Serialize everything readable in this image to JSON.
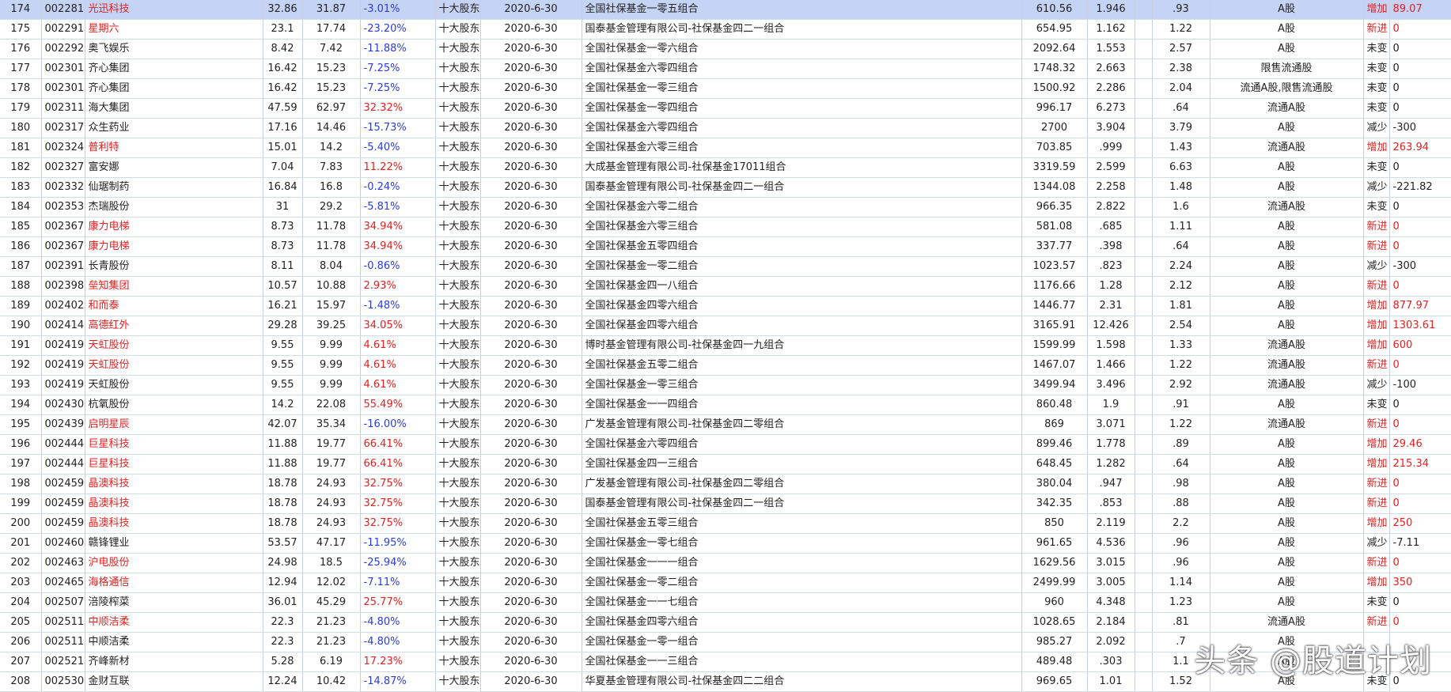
{
  "watermark": "头条 @股道计划",
  "colors": {
    "selected_row_bg": "#c5d3f5",
    "up": "#e62020",
    "down": "#2a3ddc",
    "grid": "#c8d0e0"
  },
  "rows": [
    {
      "idx": "174",
      "code": "002281",
      "name": "光迅科技",
      "name_red": true,
      "p1": "32.86",
      "p2": "31.87",
      "chg": "-3.01%",
      "holder_type": "十大股东",
      "date": "2020-6-30",
      "holder": "全国社保基金一零五组合",
      "amount": "610.56",
      "ratio": "1.946",
      "ratio2": ".93",
      "share_type": "A股",
      "change": "增加",
      "change_red": true,
      "delta": "89.07",
      "delta_red": true,
      "selected": true
    },
    {
      "idx": "175",
      "code": "002291",
      "name": "星期六",
      "name_red": true,
      "p1": "23.1",
      "p2": "17.74",
      "chg": "-23.20%",
      "holder_type": "十大股东",
      "date": "2020-6-30",
      "holder": "国泰基金管理有限公司-社保基金四二一组合",
      "amount": "654.95",
      "ratio": "1.162",
      "ratio2": "1.22",
      "share_type": "A股",
      "change": "新进",
      "change_red": true,
      "delta": "0",
      "delta_red": true
    },
    {
      "idx": "176",
      "code": "002292",
      "name": "奥飞娱乐",
      "name_red": false,
      "p1": "8.42",
      "p2": "7.42",
      "chg": "-11.88%",
      "holder_type": "十大股东",
      "date": "2020-6-30",
      "holder": "全国社保基金一零六组合",
      "amount": "2092.64",
      "ratio": "1.553",
      "ratio2": "2.57",
      "share_type": "A股",
      "change": "未变",
      "change_red": false,
      "delta": "0",
      "delta_red": false
    },
    {
      "idx": "177",
      "code": "002301",
      "name": "齐心集团",
      "name_red": false,
      "p1": "16.42",
      "p2": "15.23",
      "chg": "-7.25%",
      "holder_type": "十大股东",
      "date": "2020-6-30",
      "holder": "全国社保基金六零四组合",
      "amount": "1748.32",
      "ratio": "2.663",
      "ratio2": "2.38",
      "share_type": "限售流通股",
      "change": "未变",
      "change_red": false,
      "delta": "0",
      "delta_red": false
    },
    {
      "idx": "178",
      "code": "002301",
      "name": "齐心集团",
      "name_red": false,
      "p1": "16.42",
      "p2": "15.23",
      "chg": "-7.25%",
      "holder_type": "十大股东",
      "date": "2020-6-30",
      "holder": "全国社保基金一零三组合",
      "amount": "1500.92",
      "ratio": "2.286",
      "ratio2": "2.04",
      "share_type": "流通A股,限售流通股",
      "change": "未变",
      "change_red": false,
      "delta": "0",
      "delta_red": false
    },
    {
      "idx": "179",
      "code": "002311",
      "name": "海大集团",
      "name_red": false,
      "p1": "47.59",
      "p2": "62.97",
      "chg": "32.32%",
      "holder_type": "十大股东",
      "date": "2020-6-30",
      "holder": "全国社保基金一零四组合",
      "amount": "996.17",
      "ratio": "6.273",
      "ratio2": ".64",
      "share_type": "流通A股",
      "change": "未变",
      "change_red": false,
      "delta": "0",
      "delta_red": false
    },
    {
      "idx": "180",
      "code": "002317",
      "name": "众生药业",
      "name_red": false,
      "p1": "17.16",
      "p2": "14.46",
      "chg": "-15.73%",
      "holder_type": "十大股东",
      "date": "2020-6-30",
      "holder": "全国社保基金六零四组合",
      "amount": "2700",
      "ratio": "3.904",
      "ratio2": "3.79",
      "share_type": "A股",
      "change": "减少",
      "change_red": false,
      "delta": "-300",
      "delta_red": false
    },
    {
      "idx": "181",
      "code": "002324",
      "name": "普利特",
      "name_red": true,
      "p1": "15.01",
      "p2": "14.2",
      "chg": "-5.40%",
      "holder_type": "十大股东",
      "date": "2020-6-30",
      "holder": "全国社保基金六零三组合",
      "amount": "703.85",
      "ratio": ".999",
      "ratio2": "1.43",
      "share_type": "流通A股",
      "change": "增加",
      "change_red": true,
      "delta": "263.94",
      "delta_red": true
    },
    {
      "idx": "182",
      "code": "002327",
      "name": "富安娜",
      "name_red": false,
      "p1": "7.04",
      "p2": "7.83",
      "chg": "11.22%",
      "holder_type": "十大股东",
      "date": "2020-6-30",
      "holder": "大成基金管理有限公司-社保基金17011组合",
      "amount": "3319.59",
      "ratio": "2.599",
      "ratio2": "6.63",
      "share_type": "A股",
      "change": "未变",
      "change_red": false,
      "delta": "0",
      "delta_red": false
    },
    {
      "idx": "183",
      "code": "002332",
      "name": "仙琚制药",
      "name_red": false,
      "p1": "16.84",
      "p2": "16.8",
      "chg": "-0.24%",
      "holder_type": "十大股东",
      "date": "2020-6-30",
      "holder": "国泰基金管理有限公司-社保基金四二一组合",
      "amount": "1344.08",
      "ratio": "2.258",
      "ratio2": "1.48",
      "share_type": "A股",
      "change": "减少",
      "change_red": false,
      "delta": "-221.82",
      "delta_red": false
    },
    {
      "idx": "184",
      "code": "002353",
      "name": "杰瑞股份",
      "name_red": false,
      "p1": "31",
      "p2": "29.2",
      "chg": "-5.81%",
      "holder_type": "十大股东",
      "date": "2020-6-30",
      "holder": "全国社保基金六零二组合",
      "amount": "966.35",
      "ratio": "2.822",
      "ratio2": "1.6",
      "share_type": "流通A股",
      "change": "未变",
      "change_red": false,
      "delta": "0",
      "delta_red": false
    },
    {
      "idx": "185",
      "code": "002367",
      "name": "康力电梯",
      "name_red": true,
      "p1": "8.73",
      "p2": "11.78",
      "chg": "34.94%",
      "holder_type": "十大股东",
      "date": "2020-6-30",
      "holder": "全国社保基金六零三组合",
      "amount": "581.08",
      "ratio": ".685",
      "ratio2": "1.11",
      "share_type": "A股",
      "change": "新进",
      "change_red": true,
      "delta": "0",
      "delta_red": true
    },
    {
      "idx": "186",
      "code": "002367",
      "name": "康力电梯",
      "name_red": true,
      "p1": "8.73",
      "p2": "11.78",
      "chg": "34.94%",
      "holder_type": "十大股东",
      "date": "2020-6-30",
      "holder": "全国社保基金五零四组合",
      "amount": "337.77",
      "ratio": ".398",
      "ratio2": ".64",
      "share_type": "A股",
      "change": "新进",
      "change_red": true,
      "delta": "0",
      "delta_red": true
    },
    {
      "idx": "187",
      "code": "002391",
      "name": "长青股份",
      "name_red": false,
      "p1": "8.11",
      "p2": "8.04",
      "chg": "-0.86%",
      "holder_type": "十大股东",
      "date": "2020-6-30",
      "holder": "全国社保基金一零二组合",
      "amount": "1023.57",
      "ratio": ".823",
      "ratio2": "2.24",
      "share_type": "A股",
      "change": "减少",
      "change_red": false,
      "delta": "-300",
      "delta_red": false
    },
    {
      "idx": "188",
      "code": "002398",
      "name": "垒知集团",
      "name_red": true,
      "p1": "10.57",
      "p2": "10.88",
      "chg": "2.93%",
      "holder_type": "十大股东",
      "date": "2020-6-30",
      "holder": "全国社保基金四一八组合",
      "amount": "1176.66",
      "ratio": "1.28",
      "ratio2": "2.12",
      "share_type": "A股",
      "change": "新进",
      "change_red": true,
      "delta": "0",
      "delta_red": true
    },
    {
      "idx": "189",
      "code": "002402",
      "name": "和而泰",
      "name_red": true,
      "p1": "16.21",
      "p2": "15.97",
      "chg": "-1.48%",
      "holder_type": "十大股东",
      "date": "2020-6-30",
      "holder": "全国社保基金四零六组合",
      "amount": "1446.77",
      "ratio": "2.31",
      "ratio2": "1.81",
      "share_type": "A股",
      "change": "增加",
      "change_red": true,
      "delta": "877.97",
      "delta_red": true
    },
    {
      "idx": "190",
      "code": "002414",
      "name": "高德红外",
      "name_red": true,
      "p1": "29.28",
      "p2": "39.25",
      "chg": "34.05%",
      "holder_type": "十大股东",
      "date": "2020-6-30",
      "holder": "全国社保基金四零六组合",
      "amount": "3165.91",
      "ratio": "12.426",
      "ratio2": "2.54",
      "share_type": "A股",
      "change": "增加",
      "change_red": true,
      "delta": "1303.61",
      "delta_red": true
    },
    {
      "idx": "191",
      "code": "002419",
      "name": "天虹股份",
      "name_red": true,
      "p1": "9.55",
      "p2": "9.99",
      "chg": "4.61%",
      "holder_type": "十大股东",
      "date": "2020-6-30",
      "holder": "博时基金管理有限公司-社保基金四一九组合",
      "amount": "1599.99",
      "ratio": "1.598",
      "ratio2": "1.33",
      "share_type": "流通A股",
      "change": "增加",
      "change_red": true,
      "delta": "600",
      "delta_red": true
    },
    {
      "idx": "192",
      "code": "002419",
      "name": "天虹股份",
      "name_red": true,
      "p1": "9.55",
      "p2": "9.99",
      "chg": "4.61%",
      "holder_type": "十大股东",
      "date": "2020-6-30",
      "holder": "全国社保基金五零二组合",
      "amount": "1467.07",
      "ratio": "1.466",
      "ratio2": "1.22",
      "share_type": "流通A股",
      "change": "新进",
      "change_red": true,
      "delta": "0",
      "delta_red": true
    },
    {
      "idx": "193",
      "code": "002419",
      "name": "天虹股份",
      "name_red": false,
      "p1": "9.55",
      "p2": "9.99",
      "chg": "4.61%",
      "holder_type": "十大股东",
      "date": "2020-6-30",
      "holder": "全国社保基金一零三组合",
      "amount": "3499.94",
      "ratio": "3.496",
      "ratio2": "2.92",
      "share_type": "流通A股",
      "change": "减少",
      "change_red": false,
      "delta": "-100",
      "delta_red": false
    },
    {
      "idx": "194",
      "code": "002430",
      "name": "杭氧股份",
      "name_red": false,
      "p1": "14.2",
      "p2": "22.08",
      "chg": "55.49%",
      "holder_type": "十大股东",
      "date": "2020-6-30",
      "holder": "全国社保基金一一四组合",
      "amount": "860.48",
      "ratio": "1.9",
      "ratio2": ".91",
      "share_type": "A股",
      "change": "未变",
      "change_red": false,
      "delta": "0",
      "delta_red": false
    },
    {
      "idx": "195",
      "code": "002439",
      "name": "启明星辰",
      "name_red": true,
      "p1": "42.07",
      "p2": "35.34",
      "chg": "-16.00%",
      "holder_type": "十大股东",
      "date": "2020-6-30",
      "holder": "广发基金管理有限公司-社保基金四二零组合",
      "amount": "869",
      "ratio": "3.071",
      "ratio2": "1.22",
      "share_type": "流通A股",
      "change": "新进",
      "change_red": true,
      "delta": "0",
      "delta_red": true
    },
    {
      "idx": "196",
      "code": "002444",
      "name": "巨星科技",
      "name_red": true,
      "p1": "11.88",
      "p2": "19.77",
      "chg": "66.41%",
      "holder_type": "十大股东",
      "date": "2020-6-30",
      "holder": "全国社保基金六零四组合",
      "amount": "899.46",
      "ratio": "1.778",
      "ratio2": ".89",
      "share_type": "A股",
      "change": "增加",
      "change_red": true,
      "delta": "29.46",
      "delta_red": true
    },
    {
      "idx": "197",
      "code": "002444",
      "name": "巨星科技",
      "name_red": true,
      "p1": "11.88",
      "p2": "19.77",
      "chg": "66.41%",
      "holder_type": "十大股东",
      "date": "2020-6-30",
      "holder": "全国社保基金四一三组合",
      "amount": "648.45",
      "ratio": "1.282",
      "ratio2": ".64",
      "share_type": "A股",
      "change": "增加",
      "change_red": true,
      "delta": "215.34",
      "delta_red": true
    },
    {
      "idx": "198",
      "code": "002459",
      "name": "晶澳科技",
      "name_red": true,
      "p1": "18.78",
      "p2": "24.93",
      "chg": "32.75%",
      "holder_type": "十大股东",
      "date": "2020-6-30",
      "holder": "广发基金管理有限公司-社保基金四二零组合",
      "amount": "380.04",
      "ratio": ".947",
      "ratio2": ".98",
      "share_type": "A股",
      "change": "新进",
      "change_red": true,
      "delta": "0",
      "delta_red": true
    },
    {
      "idx": "199",
      "code": "002459",
      "name": "晶澳科技",
      "name_red": true,
      "p1": "18.78",
      "p2": "24.93",
      "chg": "32.75%",
      "holder_type": "十大股东",
      "date": "2020-6-30",
      "holder": "国泰基金管理有限公司-社保基金四二一组合",
      "amount": "342.35",
      "ratio": ".853",
      "ratio2": ".88",
      "share_type": "A股",
      "change": "新进",
      "change_red": true,
      "delta": "0",
      "delta_red": true
    },
    {
      "idx": "200",
      "code": "002459",
      "name": "晶澳科技",
      "name_red": true,
      "p1": "18.78",
      "p2": "24.93",
      "chg": "32.75%",
      "holder_type": "十大股东",
      "date": "2020-6-30",
      "holder": "全国社保基金五零三组合",
      "amount": "850",
      "ratio": "2.119",
      "ratio2": "2.2",
      "share_type": "A股",
      "change": "增加",
      "change_red": true,
      "delta": "250",
      "delta_red": true
    },
    {
      "idx": "201",
      "code": "002460",
      "name": "赣锋锂业",
      "name_red": false,
      "p1": "53.57",
      "p2": "47.17",
      "chg": "-11.95%",
      "holder_type": "十大股东",
      "date": "2020-6-30",
      "holder": "全国社保基金一零七组合",
      "amount": "961.65",
      "ratio": "4.536",
      "ratio2": ".96",
      "share_type": "A股",
      "change": "减少",
      "change_red": false,
      "delta": "-7.11",
      "delta_red": false
    },
    {
      "idx": "202",
      "code": "002463",
      "name": "沪电股份",
      "name_red": true,
      "p1": "24.98",
      "p2": "18.5",
      "chg": "-25.94%",
      "holder_type": "十大股东",
      "date": "2020-6-30",
      "holder": "全国社保基金一一一组合",
      "amount": "1629.56",
      "ratio": "3.015",
      "ratio2": ".96",
      "share_type": "A股",
      "change": "新进",
      "change_red": true,
      "delta": "0",
      "delta_red": true
    },
    {
      "idx": "203",
      "code": "002465",
      "name": "海格通信",
      "name_red": true,
      "p1": "12.94",
      "p2": "12.02",
      "chg": "-7.11%",
      "holder_type": "十大股东",
      "date": "2020-6-30",
      "holder": "全国社保基金一零二组合",
      "amount": "2499.99",
      "ratio": "3.005",
      "ratio2": "1.14",
      "share_type": "A股",
      "change": "增加",
      "change_red": true,
      "delta": "350",
      "delta_red": true
    },
    {
      "idx": "204",
      "code": "002507",
      "name": "涪陵榨菜",
      "name_red": false,
      "p1": "36.01",
      "p2": "45.29",
      "chg": "25.77%",
      "holder_type": "十大股东",
      "date": "2020-6-30",
      "holder": "全国社保基金一一七组合",
      "amount": "960",
      "ratio": "4.348",
      "ratio2": "1.23",
      "share_type": "A股",
      "change": "未变",
      "change_red": false,
      "delta": "0",
      "delta_red": false
    },
    {
      "idx": "205",
      "code": "002511",
      "name": "中顺洁柔",
      "name_red": true,
      "p1": "22.3",
      "p2": "21.23",
      "chg": "-4.80%",
      "holder_type": "十大股东",
      "date": "2020-6-30",
      "holder": "全国社保基金四零六组合",
      "amount": "1028.65",
      "ratio": "2.184",
      "ratio2": ".81",
      "share_type": "流通A股",
      "change": "新进",
      "change_red": true,
      "delta": "0",
      "delta_red": true
    },
    {
      "idx": "206",
      "code": "002511",
      "name": "中顺洁柔",
      "name_red": false,
      "p1": "22.3",
      "p2": "21.23",
      "chg": "-4.80%",
      "holder_type": "十大股东",
      "date": "2020-6-30",
      "holder": "全国社保基金一零一组合",
      "amount": "985.27",
      "ratio": "2.092",
      "ratio2": ".7",
      "share_type": "A股",
      "change": "",
      "change_red": false,
      "delta": "",
      "delta_red": false
    },
    {
      "idx": "207",
      "code": "002521",
      "name": "齐峰新材",
      "name_red": false,
      "p1": "5.28",
      "p2": "6.19",
      "chg": "17.23%",
      "holder_type": "十大股东",
      "date": "2020-6-30",
      "holder": "全国社保基金一一三组合",
      "amount": "489.48",
      "ratio": ".303",
      "ratio2": "1.1",
      "share_type": "A股",
      "change": "",
      "change_red": false,
      "delta": "",
      "delta_red": false
    },
    {
      "idx": "208",
      "code": "002530",
      "name": "金财互联",
      "name_red": false,
      "p1": "12.24",
      "p2": "10.42",
      "chg": "-14.87%",
      "holder_type": "十大股东",
      "date": "2020-6-30",
      "holder": "华夏基金管理有限公司-社保基金四二二组合",
      "amount": "969.65",
      "ratio": "1.01",
      "ratio2": "1.52",
      "share_type": "A股",
      "change": "未变",
      "change_red": false,
      "delta": "0",
      "delta_red": false
    }
  ]
}
